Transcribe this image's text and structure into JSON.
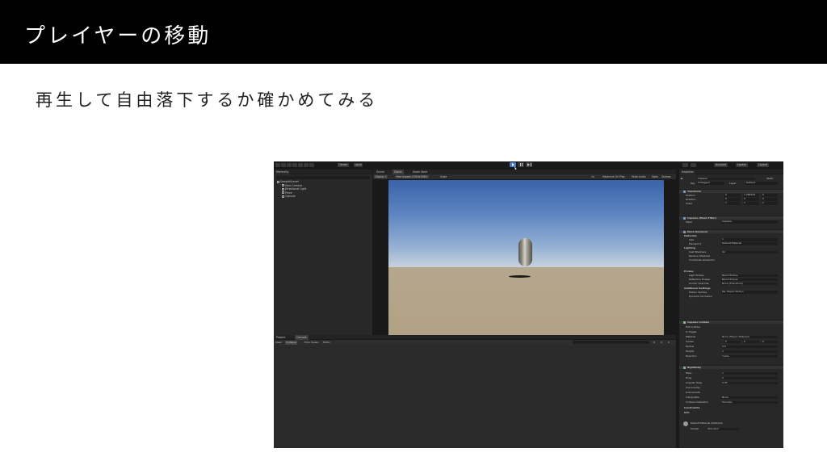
{
  "slide": {
    "title": "プレイヤーの移動",
    "body": "再生して自由落下するか確かめてみる"
  },
  "colors": {
    "header_bg": "#000000",
    "editor_bg": "#191919",
    "panel_bg": "#282828",
    "play_active": "#4a78c4",
    "sky_top": "#3a63a8",
    "ground": "#b5a78e"
  },
  "unity": {
    "toolbar": {
      "pivot": "Center",
      "space": "Local",
      "account": "Account",
      "layers": "Layers",
      "layout": "Layout"
    },
    "hierarchy": {
      "tab": "Hierarchy",
      "items": [
        {
          "label": "SampleScene*"
        },
        {
          "label": "Main Camera"
        },
        {
          "label": "Directional Light"
        },
        {
          "label": "Plane"
        },
        {
          "label": "Capsule"
        }
      ]
    },
    "game": {
      "tabs": [
        "Scene",
        "Game",
        "Asset Store"
      ],
      "display": "Display 1",
      "resolution": "Free Aspect (1920x1080)",
      "scale_label": "Scale",
      "scale_value": "1x",
      "right_opts": [
        "Maximize On Play",
        "Mute Audio",
        "Stats",
        "Gizmos"
      ]
    },
    "console": {
      "tabs": [
        "Project",
        "Console"
      ],
      "buttons": [
        "Clear",
        "Collapse",
        "Error Pause",
        "Editor"
      ],
      "counts": [
        "0",
        "0",
        "0"
      ]
    },
    "inspector": {
      "tab": "Inspector",
      "object_name": "Capsule",
      "static": "Static",
      "tag_label": "Tag",
      "tag_value": "Untagged",
      "layer_label": "Layer",
      "layer_value": "Default",
      "transform": {
        "title": "Transform",
        "position": {
          "label": "Position",
          "x": "0",
          "y": "1.066229",
          "z": "0"
        },
        "rotation": {
          "label": "Rotation",
          "x": "0",
          "y": "0",
          "z": "0"
        },
        "scale": {
          "label": "Scale",
          "x": "1",
          "y": "1",
          "z": "1"
        }
      },
      "mesh_filter": {
        "title": "Capsule (Mesh Filter)",
        "mesh_label": "Mesh",
        "mesh_value": "Capsule"
      },
      "mesh_renderer": {
        "title": "Mesh Renderer",
        "materials": "Materials",
        "size_label": "Size",
        "size_value": "1",
        "element_label": "Element 0",
        "element_value": "Default-Material",
        "lighting": "Lighting",
        "cast_shadows_label": "Cast Shadows",
        "cast_shadows_value": "On",
        "receive_shadows_label": "Receive Shadows",
        "contribute_gi_label": "Contribute Global Illu",
        "probes": "Probes",
        "light_probes_label": "Light Probes",
        "light_probes_value": "Blend Probes",
        "reflection_probes_label": "Reflection Probes",
        "reflection_probes_value": "Blend Probes",
        "anchor_label": "Anchor Override",
        "anchor_value": "None (Transform)",
        "additional": "Additional Settings",
        "motion_vectors_label": "Motion Vectors",
        "motion_vectors_value": "Per Object Motion",
        "dynamic_occl_label": "Dynamic Occlusion"
      },
      "capsule_collider": {
        "title": "Capsule Collider",
        "edit_label": "Edit Collider",
        "trigger_label": "Is Trigger",
        "material_label": "Material",
        "material_value": "None (Physic Material)",
        "center_label": "Center",
        "center_x": "0",
        "center_y": "0",
        "center_z": "0",
        "radius_label": "Radius",
        "radius_value": "0.5",
        "height_label": "Height",
        "height_value": "2",
        "direction_label": "Direction",
        "direction_value": "Y-Axis"
      },
      "rigidbody": {
        "title": "Rigidbody",
        "mass_label": "Mass",
        "mass_value": "1",
        "drag_label": "Drag",
        "drag_value": "0",
        "angular_label": "Angular Drag",
        "angular_value": "0.05",
        "gravity_label": "Use Gravity",
        "kinematic_label": "Is Kinematic",
        "interpolate_label": "Interpolate",
        "interpolate_value": "None",
        "collision_label": "Collision Detection",
        "collision_value": "Discrete",
        "constraints": "Constraints",
        "info": "Info"
      },
      "material": {
        "name": "Default-Material (Material)",
        "shader_label": "Shader",
        "shader_value": "Standard"
      }
    }
  }
}
